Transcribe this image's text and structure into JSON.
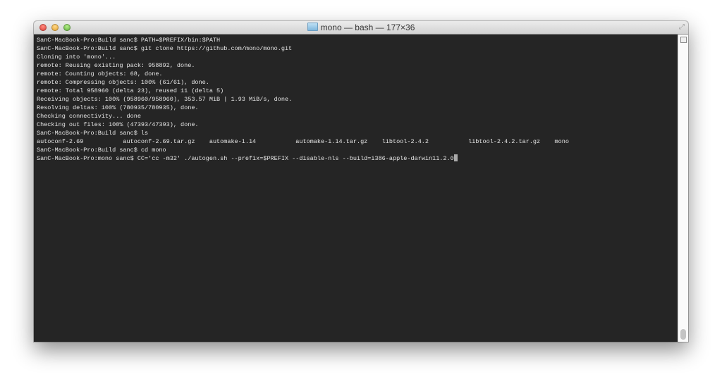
{
  "window": {
    "title": "mono — bash — 177×36"
  },
  "terminal": {
    "lines": [
      "SanC-MacBook-Pro:Build sanc$ PATH=$PREFIX/bin:$PATH",
      "SanC-MacBook-Pro:Build sanc$ git clone https://github.com/mono/mono.git",
      "Cloning into 'mono'...",
      "remote: Reusing existing pack: 958892, done.",
      "remote: Counting objects: 68, done.",
      "remote: Compressing objects: 100% (61/61), done.",
      "remote: Total 958960 (delta 23), reused 11 (delta 5)",
      "Receiving objects: 100% (958960/958960), 353.57 MiB | 1.93 MiB/s, done.",
      "Resolving deltas: 100% (780935/780935), done.",
      "Checking connectivity... done",
      "Checking out files: 100% (47393/47393), done.",
      "SanC-MacBook-Pro:Build sanc$ ls",
      "autoconf-2.69           autoconf-2.69.tar.gz    automake-1.14           automake-1.14.tar.gz    libtool-2.4.2           libtool-2.4.2.tar.gz    mono",
      "SanC-MacBook-Pro:Build sanc$ cd mono"
    ],
    "current_line": "SanC-MacBook-Pro:mono sanc$ CC='cc -m32' ./autogen.sh --prefix=$PREFIX --disable-nls --build=i386-apple-darwin11.2.0"
  }
}
